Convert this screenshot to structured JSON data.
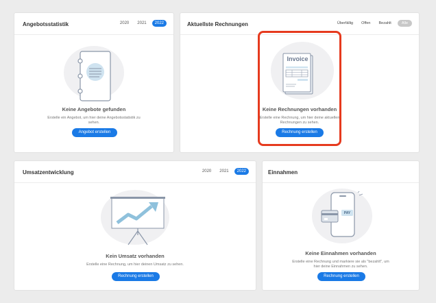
{
  "angebote": {
    "title": "Angebotsstatistik",
    "years": [
      "2020",
      "2021",
      "2022"
    ],
    "active_year": "2022",
    "empty_title": "Keine Angebote gefunden",
    "empty_desc_1": "Erstelle ein Angebot, um hier deine Angebotsstatistik zu",
    "empty_desc_2": "sehen.",
    "button": "Angebot erstellen"
  },
  "rechnungen": {
    "title": "Aktuellste Rechnungen",
    "filters": [
      "Überfällig",
      "Offen",
      "Bezahlt",
      "Alle"
    ],
    "active_filter": "Alle",
    "invoice_label": "Invoice",
    "empty_title": "Keine Rechnungen vorhanden",
    "empty_desc_1": "Erstelle eine Rechnung, um hier deine aktuellen",
    "empty_desc_2": "Rechnungen zu sehen.",
    "button": "Rechnung erstellen"
  },
  "umsatz": {
    "title": "Umsatzentwicklung",
    "years": [
      "2020",
      "2021",
      "2022"
    ],
    "active_year": "2022",
    "empty_title": "Kein Umsatz vorhanden",
    "empty_desc": "Erstelle eine Rechnung, um hier deinen Umsatz zu sehen.",
    "button": "Rechnung erstellen"
  },
  "einnahmen": {
    "title": "Einnahmen",
    "pay_label": "PAY",
    "empty_title": "Keine Einnahmen vorhanden",
    "empty_desc_1": "Erstelle eine Rechnung und markiere sie als \"bezahlt\", um",
    "empty_desc_2": "hier deine Einnahmen zu sehen.",
    "button": "Rechnung erstellen"
  },
  "colors": {
    "accent": "#1a7ae6",
    "highlight": "#e63a1e",
    "illustration_line": "#8a96a8",
    "illustration_fill": "#cfe3f0"
  }
}
